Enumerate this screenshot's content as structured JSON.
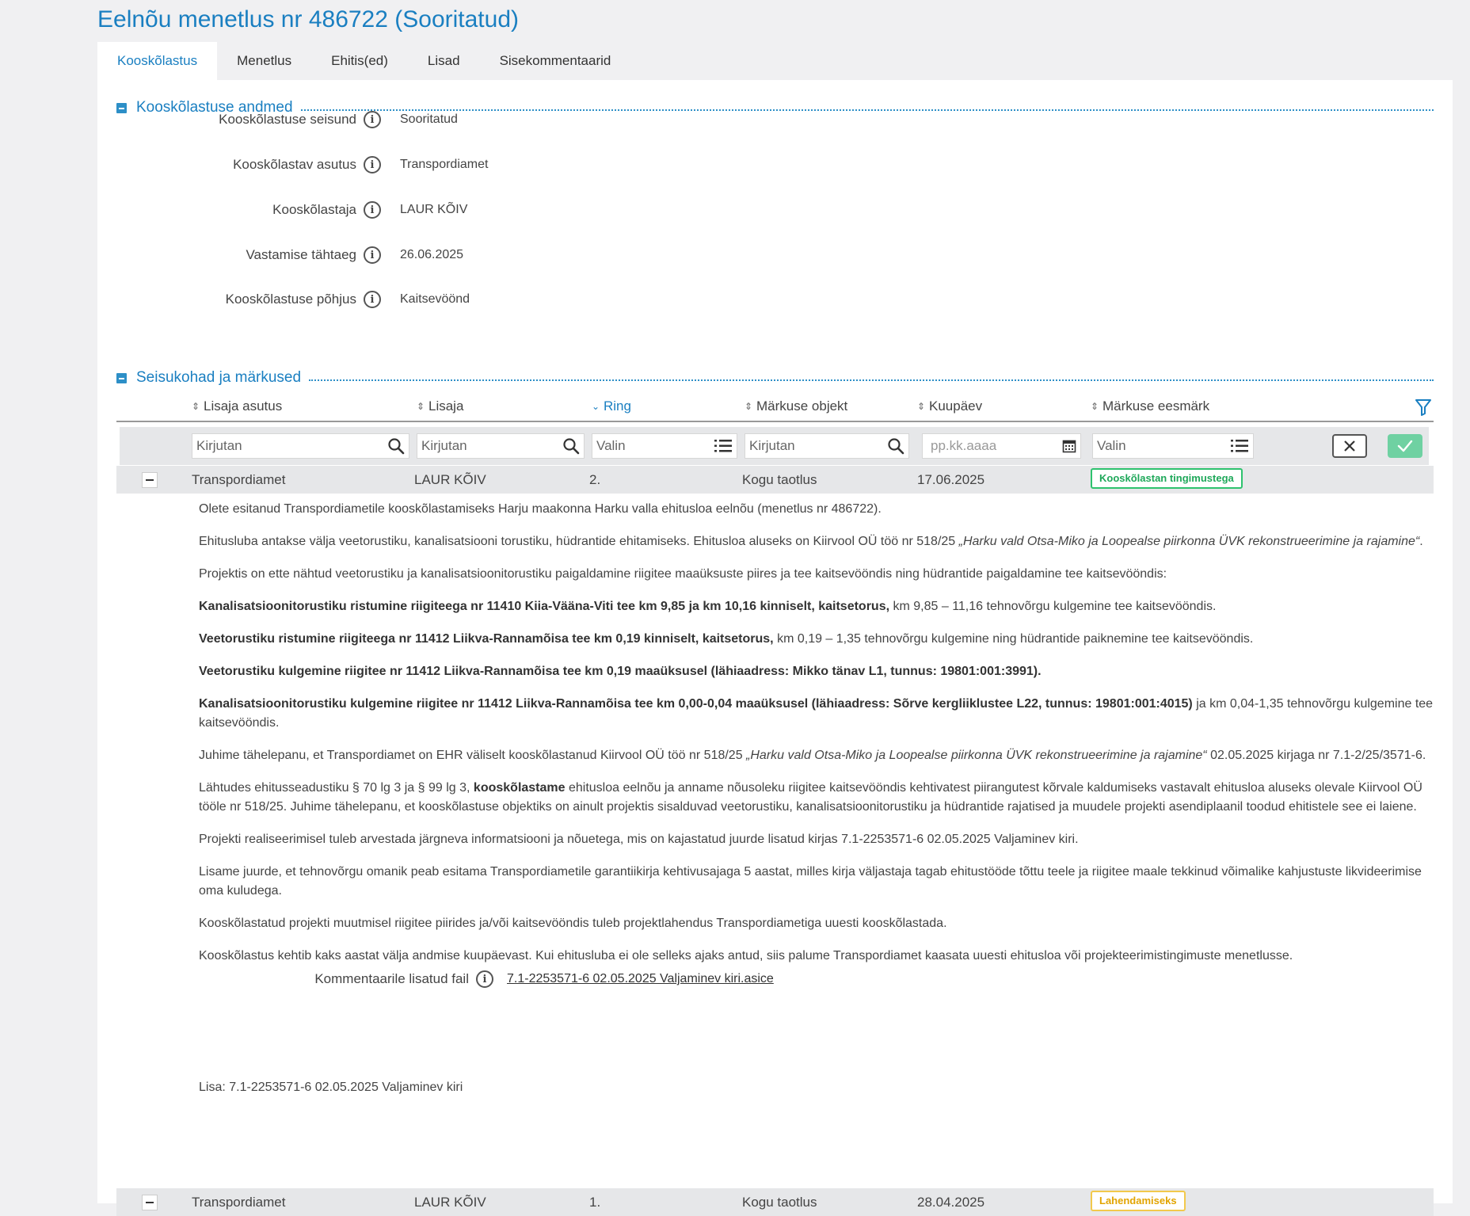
{
  "page": {
    "title": "Eelnõu menetlus nr 486722 (Sooritatud)"
  },
  "tabs": [
    {
      "label": "Kooskõlastus",
      "active": true
    },
    {
      "label": "Menetlus"
    },
    {
      "label": "Ehitis(ed)"
    },
    {
      "label": "Lisad"
    },
    {
      "label": "Sisekommentaarid"
    }
  ],
  "section1": {
    "title": "Kooskõlastuse andmed",
    "fields": [
      {
        "label": "Kooskõlastuse seisund",
        "value": "Sooritatud"
      },
      {
        "label": "Kooskõlastav asutus",
        "value": "Transpordiamet"
      },
      {
        "label": "Kooskõlastaja",
        "value": "LAUR KÕIV"
      },
      {
        "label": "Vastamise tähtaeg",
        "value": "26.06.2025"
      },
      {
        "label": "Kooskõlastuse põhjus",
        "value": "Kaitsevöönd"
      }
    ]
  },
  "section2": {
    "title": "Seisukohad ja märkused",
    "columns": [
      "Lisaja asutus",
      "Lisaja",
      "Ring",
      "Märkuse objekt",
      "Kuupäev",
      "Märkuse eesmärk"
    ],
    "filters": {
      "lisaja_asutus": "Kirjutan",
      "lisaja": "Kirjutan",
      "ring": "Valin",
      "objekt": "Kirjutan",
      "kuupaev": "pp.kk.aaaa",
      "eesmark": "Valin"
    },
    "rows": [
      {
        "asutus": "Transpordiamet",
        "lisaja": "LAUR KÕIV",
        "ring": "2.",
        "objekt": "Kogu taotlus",
        "kuupaev": "17.06.2025",
        "eesmark": "Kooskõlastan tingimustega",
        "badge_color": "#2ec26e"
      },
      {
        "asutus": "Transpordiamet",
        "lisaja": "LAUR KÕIV",
        "ring": "1.",
        "objekt": "Kogu taotlus",
        "kuupaev": "28.04.2025",
        "eesmark": "Lahendamiseks",
        "badge_color": "#f2c94c"
      }
    ]
  },
  "comment": {
    "p1": "Olete esitanud Transpordiametile kooskõlastamiseks Harju maakonna Harku valla ehitusloa eelnõu (menetlus nr 486722).",
    "p2_text": "Ehitusluba antakse välja veetorustiku, kanalisatsiooni torustiku, hüdrantide  ehitamiseks. Ehitusloa aluseks on Kiirvool OÜ töö nr 518/25 ",
    "p2_italic": "„Harku vald Otsa-Miko ja Loopealse piirkonna ÜVK rekonstrueerimine ja rajamine“",
    "p2_end": ".",
    "p3": "Projektis on ette nähtud veetorustiku ja kanalisatsioonitorustiku paigaldamine riigitee maaüksuste piires ja tee kaitsevööndis ning hüdrantide paigaldamine tee kaitsevööndis:",
    "p4_bold": "Kanalisatsioonitorustiku ristumine riigiteega nr 11410 Kiia-Vääna-Viti tee km 9,85 ja km 10,16 kinniselt, kaitsetorus,",
    "p4_text": " km 9,85 – 11,16 tehnovõrgu kulgemine tee kaitsevööndis.",
    "p5_bold": "Veetorustiku ristumine riigiteega nr 11412 Liikva-Rannamõisa tee km 0,19 kinniselt, kaitsetorus,",
    "p5_text": " km 0,19 – 1,35 tehnovõrgu kulgemine ning hüdrantide paiknemine tee kaitsevööndis.",
    "p6_bold": "Veetorustiku kulgemine riigitee nr 11412 Liikva-Rannamõisa tee km 0,19 maaüksusel (lähiaadress: Mikko tänav L1, tunnus: 19801:001:3991).",
    "p7_bold": "Kanalisatsioonitorustiku kulgemine riigitee nr 11412 Liikva-Rannamõisa tee km 0,00-0,04 maaüksusel (lähiaadress: Sõrve kergliiklustee L22, tunnus: 19801:001:4015)",
    "p7_text": " ja km 0,04-1,35 tehnovõrgu kulgemine tee kaitsevööndis.",
    "p8_text": "Juhime tähelepanu, et Transpordiamet on EHR väliselt kooskõlastanud Kiirvool OÜ töö nr 518/25 ",
    "p8_italic": "„Harku vald Otsa-Miko ja Loopealse piirkonna ÜVK rekonstrueerimine ja rajamine“",
    "p8_end": " 02.05.2025 kirjaga nr 7.1-2/25/3571-6.",
    "p9_start": "Lähtudes ehitusseadustiku § 70 lg 3 ja § 99 lg 3, ",
    "p9_bold": "kooskõlastame",
    "p9_text": " ehitusloa eelnõu ja anname nõusoleku riigitee kaitsevööndis kehtivatest piirangutest kõrvale kaldumiseks vastavalt ehitusloa aluseks olevale Kiirvool OÜ tööle nr 518/25. Juhime tähelepanu, et kooskõlastuse objektiks on ainult projektis sisalduvad veetorustiku, kanalisatsioonitorustiku ja hüdrantide rajatised ja muudele projekti asendiplaanil toodud ehitistele see ei laiene.",
    "p10": "Projekti realiseerimisel tuleb arvestada järgneva informatsiooni ja nõuetega, mis on kajastatud juurde lisatud kirjas 7.1-2253571-6 02.05.2025 Valjaminev kiri.",
    "p11": "Lisame juurde, et tehnovõrgu omanik peab esitama Transpordiametile garantiikirja kehtivusajaga 5 aastat, milles kirja väljastaja tagab ehitustööde tõttu teele ja riigitee maale tekkinud võimalike kahjustuste likvideerimise oma kuludega.",
    "p12": "Kooskõlastatud projekti muutmisel riigitee piirides ja/või kaitsevööndis tuleb projektlahendus Transpordiametiga uuesti kooskõlastada.",
    "p13": "Kooskõlastus kehtib kaks aastat välja andmise kuupäevast. Kui ehitusluba ei ole selleks ajaks antud, siis palume Transpordiamet kaasata uuesti ehitusloa või projekteerimistingimuste menetlusse.",
    "lisa": "Lisa: 7.1-2253571-6 02.05.2025 Valjaminev kiri"
  },
  "attachment": {
    "label": "Kommentaarile lisatud fail",
    "file": "7.1-2253571-6 02.05.2025 Valjaminev kiri.asice"
  },
  "icons": {
    "info": "info-circle-icon",
    "sort": "sort-arrows-icon",
    "filter": "filter-funnel-icon",
    "search": "search-icon",
    "list": "list-icon",
    "calendar": "calendar-icon",
    "clear": "close-icon",
    "apply": "check-icon"
  },
  "colors": {
    "accent": "#1a7fc1",
    "success": "#6fd1a2",
    "warning": "#f2c94c"
  }
}
